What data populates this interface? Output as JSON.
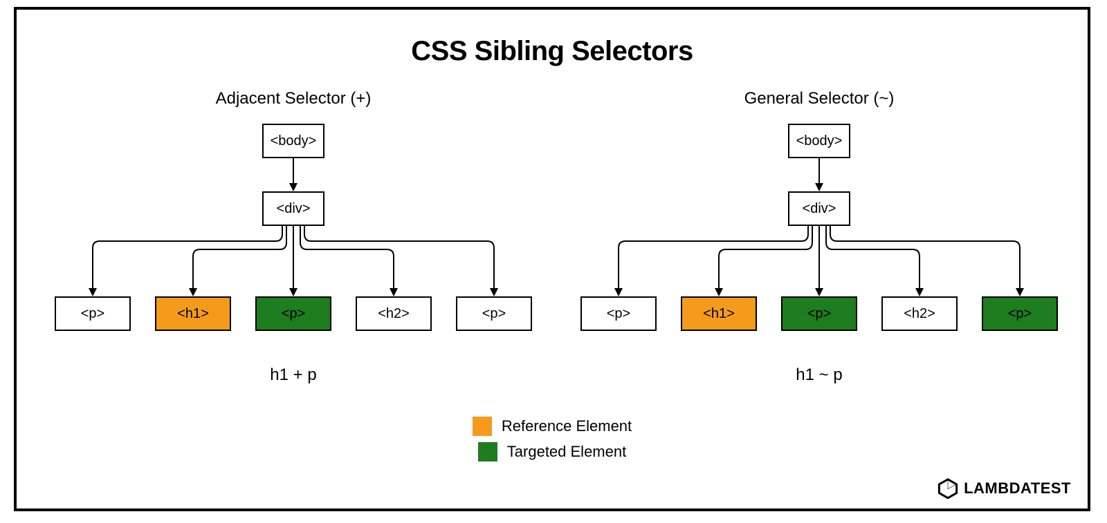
{
  "title": "CSS Sibling Selectors",
  "trees": {
    "adjacent": {
      "subtitle": "Adjacent Selector (+)",
      "body_label": "<body>",
      "div_label": "<div>",
      "leaves": [
        {
          "label": "<p>",
          "kind": "plain"
        },
        {
          "label": "<h1>",
          "kind": "ref"
        },
        {
          "label": "<p>",
          "kind": "target"
        },
        {
          "label": "<h2>",
          "kind": "plain"
        },
        {
          "label": "<p>",
          "kind": "plain"
        }
      ],
      "expression": "h1 + p"
    },
    "general": {
      "subtitle": "General Selector (~)",
      "body_label": "<body>",
      "div_label": "<div>",
      "leaves": [
        {
          "label": "<p>",
          "kind": "plain"
        },
        {
          "label": "<h1>",
          "kind": "ref"
        },
        {
          "label": "<p>",
          "kind": "target"
        },
        {
          "label": "<h2>",
          "kind": "plain"
        },
        {
          "label": "<p>",
          "kind": "target"
        }
      ],
      "expression": "h1 ~ p"
    }
  },
  "legend": {
    "reference": {
      "label": "Reference Element",
      "color": "#f59b1c"
    },
    "targeted": {
      "label": "Targeted Element",
      "color": "#1e7d1e"
    }
  },
  "brand": "LAMBDATEST"
}
